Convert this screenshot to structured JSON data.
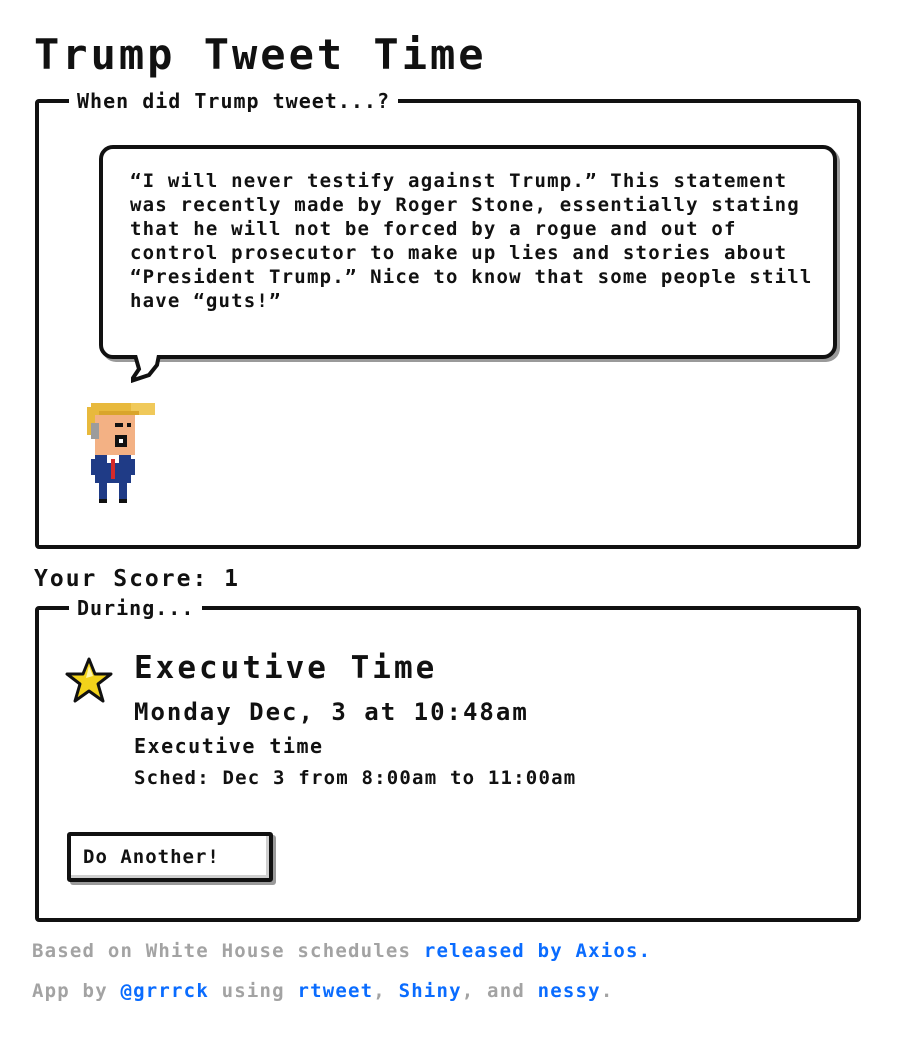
{
  "app": {
    "title": "Trump Tweet Time"
  },
  "quiz": {
    "legend": "When did Trump tweet...?",
    "tweet": "“I will never testify against Trump.” This statement was recently made by Roger Stone, essentially stating that he will not be forced by a rogue and out of control prosecutor to make up lies and stories about “President Trump.” Nice to know that some people still have “guts!”"
  },
  "score": {
    "text": "Your Score: 1"
  },
  "result": {
    "legend": "During...",
    "icon": "star-icon",
    "title": "Executive Time",
    "datetime": "Monday Dec, 3 at 10:48am",
    "description": "Executive time",
    "schedule": "Sched: Dec 3 from 8:00am to 11:00am",
    "button_label": "Do Another!"
  },
  "footer": {
    "line1_prefix": "Based on White House schedules ",
    "line1_link": "released by Axios.",
    "line2_prefix": "App by ",
    "line2_link_author": "@grrrck",
    "line2_mid": " using ",
    "line2_link_rtweet": "rtweet",
    "line2_sep": ", ",
    "line2_link_shiny": "Shiny",
    "line2_and": ", and ",
    "line2_link_nessy": "nessy",
    "line2_end": "."
  },
  "colors": {
    "link": "#0a6cff",
    "muted": "#a3a3a3",
    "ink": "#111111",
    "star": "#f2d21b"
  }
}
